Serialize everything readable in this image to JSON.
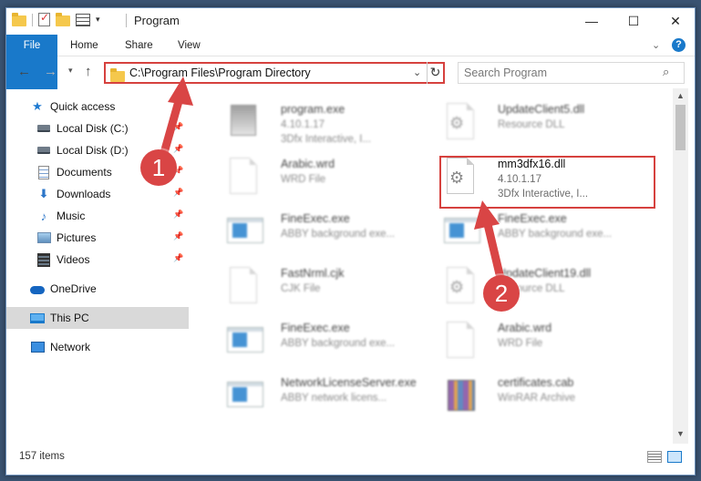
{
  "window": {
    "title": "Program",
    "controls": {
      "minimize": "—",
      "maximize": "☐",
      "close": "✕"
    }
  },
  "ribbon": {
    "tabs": [
      "File",
      "Home",
      "Share",
      "View"
    ]
  },
  "address": {
    "path": "C:\\Program Files\\Program Directory",
    "search_placeholder": "Search Program"
  },
  "nav_pane": {
    "items": [
      {
        "label": "Quick access",
        "icon": "star-icon",
        "pinned": false
      },
      {
        "label": "Local Disk (C:)",
        "icon": "disk-icon",
        "pinned": true
      },
      {
        "label": "Local Disk (D:)",
        "icon": "disk-icon",
        "pinned": true
      },
      {
        "label": "Documents",
        "icon": "documents-icon",
        "pinned": true
      },
      {
        "label": "Downloads",
        "icon": "downloads-icon",
        "pinned": true
      },
      {
        "label": "Music",
        "icon": "music-icon",
        "pinned": true
      },
      {
        "label": "Pictures",
        "icon": "pictures-icon",
        "pinned": true
      },
      {
        "label": "Videos",
        "icon": "videos-icon",
        "pinned": true
      },
      {
        "label": "OneDrive",
        "icon": "onedrive-icon",
        "pinned": false
      },
      {
        "label": "This PC",
        "icon": "this-pc-icon",
        "pinned": false,
        "selected": true
      },
      {
        "label": "Network",
        "icon": "network-icon",
        "pinned": false
      }
    ]
  },
  "files": [
    {
      "name": "program.exe",
      "line1": "4.10.1.17",
      "line2": "3Dfx Interactive, I...",
      "kind": "program"
    },
    {
      "name": "UpdateClient5.dll",
      "line1": "Resource DLL",
      "line2": "",
      "kind": "dll"
    },
    {
      "name": "Arabic.wrd",
      "line1": "WRD File",
      "line2": "",
      "kind": "page"
    },
    {
      "name": "mm3dfx16.dll",
      "line1": "4.10.1.17",
      "line2": "3Dfx Interactive, I...",
      "kind": "dll",
      "highlighted": true
    },
    {
      "name": "FineExec.exe",
      "line1": "ABBY background exe...",
      "line2": "",
      "kind": "exe"
    },
    {
      "name": "FineExec.exe",
      "line1": "ABBY background exe...",
      "line2": "",
      "kind": "exe"
    },
    {
      "name": "FastNrml.cjk",
      "line1": "CJK File",
      "line2": "",
      "kind": "page"
    },
    {
      "name": "UpdateClient19.dll",
      "line1": "Resource DLL",
      "line2": "",
      "kind": "dll"
    },
    {
      "name": "FineExec.exe",
      "line1": "ABBY background exe...",
      "line2": "",
      "kind": "exe"
    },
    {
      "name": "Arabic.wrd",
      "line1": "WRD File",
      "line2": "",
      "kind": "page"
    },
    {
      "name": "NetworkLicenseServer.exe",
      "line1": "ABBY network licens...",
      "line2": "",
      "kind": "exe"
    },
    {
      "name": "certificates.cab",
      "line1": "WinRAR Archive",
      "line2": "",
      "kind": "cab"
    }
  ],
  "status": {
    "item_count": "157 items"
  },
  "annotations": {
    "marker1": "1",
    "marker2": "2"
  },
  "colors": {
    "accent": "#1979ca",
    "annotation_red": "#d94545"
  }
}
